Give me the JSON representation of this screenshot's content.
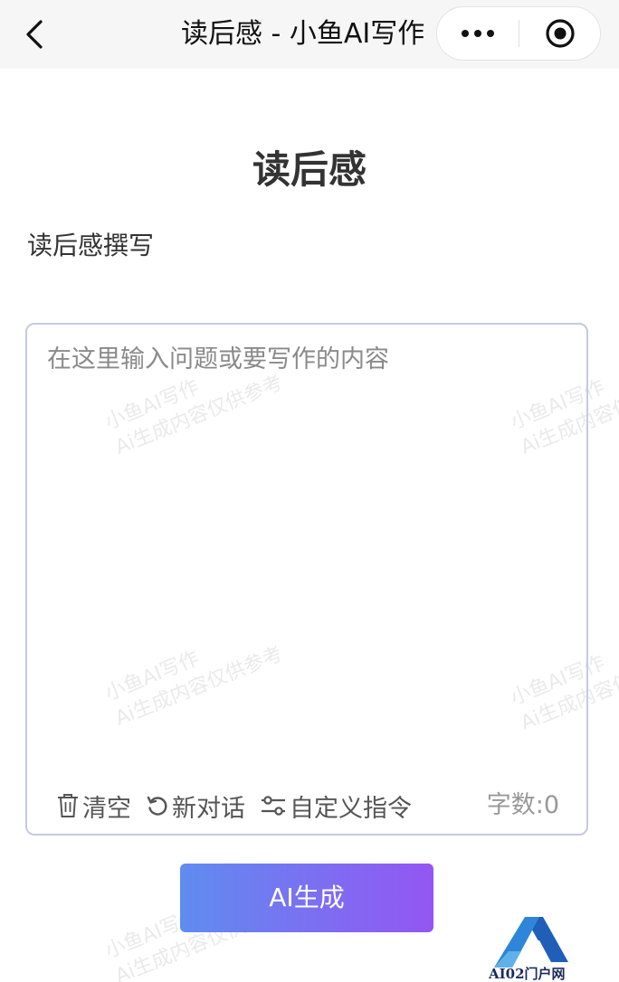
{
  "navbar": {
    "title": "读后感 - 小鱼AI写作",
    "back_icon": "chevron-left-icon",
    "more_icon": "more-dots-icon",
    "close_icon": "target-circle-icon"
  },
  "main": {
    "title": "读后感",
    "subtitle": "读后感撰写",
    "input": {
      "value": "",
      "placeholder": "在这里输入问题或要写作的内容"
    },
    "toolbar": {
      "clear_label": "清空",
      "new_chat_label": "新对话",
      "custom_label": "自定义指令",
      "word_count": "字数:0"
    },
    "generate_label": "AI生成"
  },
  "watermark": {
    "line1": "小鱼AI写作",
    "line2": "Ai生成内容仅供参考"
  },
  "corner_logo": {
    "text": "AI02门户网"
  },
  "colors": {
    "button_gradient_start": "#5f8cf0",
    "button_gradient_end": "#9456f2",
    "card_border": "#c5c9e6",
    "navbar_bg": "#f6f6f6"
  }
}
